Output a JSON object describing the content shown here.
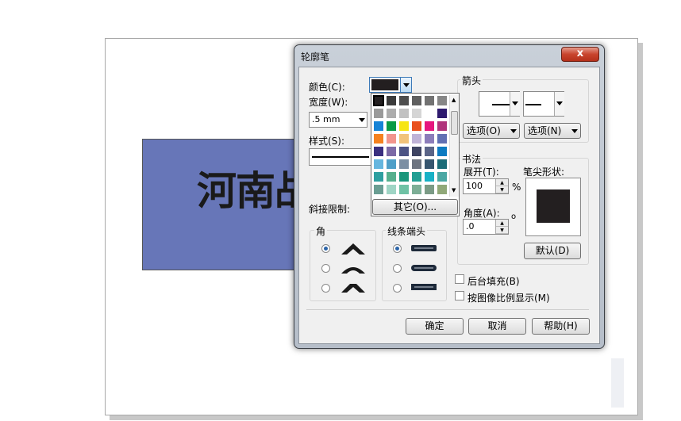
{
  "canvas": {
    "sample_text": "河南战"
  },
  "dialog": {
    "title": "轮廓笔",
    "close_label": "x",
    "color_label": "颜色(C):",
    "width_label": "宽度(W):",
    "width_value": ".5 mm",
    "style_label": "样式(S):",
    "miter_label": "斜接限制:",
    "corner_group": "角",
    "linecap_group": "线条端头",
    "arrows_group": "箭头",
    "arrow_option_left": "选项(O)",
    "arrow_option_right": "选项(N)",
    "calligraphy_group": "书法",
    "stretch_label": "展开(T):",
    "stretch_value": "100",
    "stretch_unit": "%",
    "nib_shape_label": "笔尖形状:",
    "angle_label": "角度(A):",
    "angle_value": ".0",
    "angle_unit": "o",
    "default_button": "默认(D)",
    "behind_fill_label": "后台填充(B)",
    "scale_image_label": "按图像比例显示(M)",
    "ok_button": "确定",
    "cancel_button": "取消",
    "help_button": "帮助(H)",
    "other_color_button": "其它(O)...",
    "selected_color": "#231f20",
    "palette_colors": [
      "#231f20",
      "#3b3b3b",
      "#4d4d4d",
      "#5f5f5f",
      "#727272",
      "#868686",
      "#9a9a9a",
      "#adadad",
      "#c1c1c1",
      "#d5d5d5",
      "#ffffff",
      "#2e1a6e",
      "#1683d6",
      "#0a9a45",
      "#f6e514",
      "#e9501e",
      "#e6157e",
      "#b0347b",
      "#f58220",
      "#f2958d",
      "#f1c37a",
      "#bfb3d7",
      "#8c7dba",
      "#6170b3",
      "#3a2f7f",
      "#7c6aa6",
      "#4d5484",
      "#3e4462",
      "#5a6487",
      "#0c7bc1",
      "#66b6df",
      "#4f9fc8",
      "#7b8fa3",
      "#6d7480",
      "#37566f",
      "#1a6b77",
      "#2e9fa0",
      "#56b08e",
      "#1a977c",
      "#229f94",
      "#17b1c6",
      "#4aa7a3",
      "#6a9e93",
      "#9fd5c5",
      "#6fc2a5",
      "#7dae96",
      "#7b9b86",
      "#90a878"
    ]
  }
}
